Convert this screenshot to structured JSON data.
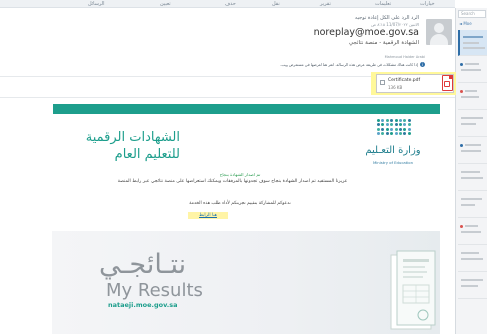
{
  "topbar": {
    "items": [
      "الرسائل",
      "تعيين",
      "حذف",
      "نقل",
      "تقرير",
      "تعليمات",
      "خيارات"
    ]
  },
  "search_pane": {
    "search_placeholder": "Search",
    "more_label": "◄ Moe",
    "items": 10,
    "accent_color": "#2f6ea7"
  },
  "message_header": {
    "actions": "الرد  الرد على الكل  إعادة توجيه",
    "date": "الاثنين 11/07/٢٠٢٢ ٨:١٥ ص",
    "sender_email": "noreplay@moe.gov.sa",
    "sender_name": "الشهادة الرقمية - منصة نتائجي",
    "recipient": "Mahmoud Haider Arabi",
    "info_text": "إذا كانت هناك مشكلات في طريقة عرض هذه الرسالة، انقر هنا لعرضها في مستعرض ويب."
  },
  "attachment": {
    "file_name": "Certificate.pdf",
    "file_size": "136 KB",
    "icon": "pdf-file-icon",
    "highlight_color": "#fff89a"
  },
  "email": {
    "brand_color": "#1d9e8c",
    "logo": {
      "arabic": "وزارة التعـليم",
      "english": "Ministry of Education"
    },
    "title_line1": "الشهادات الرقمية",
    "title_line2": "للتعليم العام",
    "greeting": "تم اصدار الشهادة بنجاح",
    "paragraph": "عزيزنا المستفيد تم اصدار الشهادة بنجاح سوف تجدونها بالمرفقات ويمكنك استعراضها على منصة نتائجي عبر رابط المنصة",
    "survey_invite": "ندعوكم للمشاركة بتقييم تجربتكم لأداء طلب هذه الخدمة",
    "survey_link": "هنا الرابط",
    "banner": {
      "arabic": "نتـائجـي",
      "english": "My Results",
      "url": "nataeji.moe.gov.sa"
    }
  }
}
